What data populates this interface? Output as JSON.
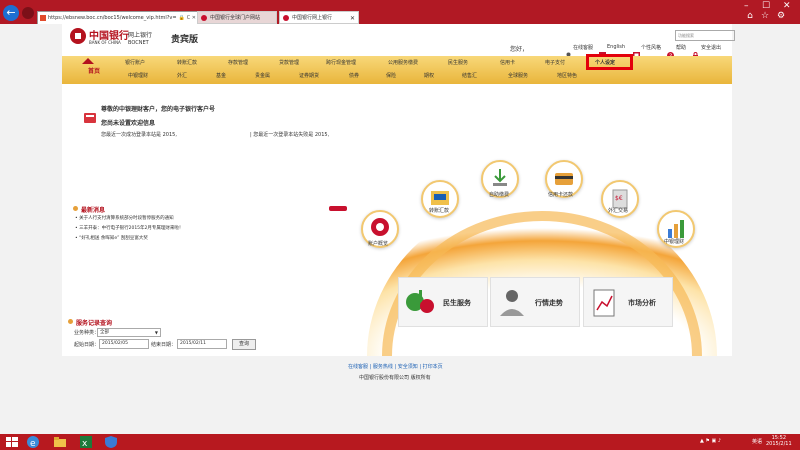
{
  "browser": {
    "url": "https://ebsnew.boc.cn/boc15/welcome_vip.html?v=",
    "tabs": [
      {
        "label": "中国银行全球门户网站"
      },
      {
        "label": "中国银行网上银行"
      }
    ]
  },
  "header": {
    "logo_cn": "中国银行",
    "logo_en": "BANK OF CHINA",
    "netbank_cn": "网上银行",
    "netbank_en": "BOCNET",
    "edition": "贵宾版",
    "search_placeholder": "功能搜索",
    "greeting": "您好，",
    "links": [
      "在线客服",
      "English",
      "个性风格",
      "帮助",
      "安全退出"
    ]
  },
  "nav": {
    "home": "首页",
    "row1": [
      "银行账户",
      "转账汇款",
      "存款管理",
      "贷款管理",
      "跨行现金管理",
      "公用服务缴费",
      "民生服务",
      "信用卡",
      "电子支付",
      "个人设定"
    ],
    "row2": [
      "中银理财",
      "外汇",
      "基金",
      "贵金属",
      "证券期货",
      "债券",
      "保险",
      "期权",
      "结售汇",
      "全球服务",
      "地区特色"
    ],
    "highlighted": "个人设定"
  },
  "welcome": {
    "line1": "尊敬的中银理财客户，您的电子银行客户号",
    "line2": "您尚未设置欢迎信息",
    "line3": "您最近一次成功登录本站是 2015,",
    "line4": "| 您最近一次登录本站失败是 2015,"
  },
  "news": {
    "title": "最新消息",
    "items": [
      "关于人行支付清算系统部分时段暂停服务的通知",
      "三羊开泰：中行电子银行2015年2月专属理财来啦！",
      "“好礼相送 余晖知e” 刮刮豆富大奖"
    ]
  },
  "services": {
    "bubbles": [
      "账户概览",
      "转账汇款",
      "自助缴费",
      "信用卡还款",
      "外汇交易",
      "中银理财"
    ],
    "cards": [
      "民生服务",
      "行情走势",
      "市场分析"
    ]
  },
  "query": {
    "title": "服务记录查询",
    "type_label": "业务种类：",
    "type_value": "全部",
    "start_label": "起始日期：",
    "start_value": "2015/02/05",
    "end_label": "结束日期：",
    "end_value": "2015/02/11",
    "button": "查询"
  },
  "footer": {
    "links": "在线客服 | 服务热线 | 安全须知 | 打印本页",
    "copyright": "中国银行股份有限公司  版权所有"
  },
  "taskbar": {
    "time": "15:52",
    "date": "2015/2/11",
    "lang": "英语"
  },
  "colors": {
    "brand_red": "#b4121e",
    "nav_gold": "#e9b53b",
    "highlight_red": "#e3000b"
  }
}
